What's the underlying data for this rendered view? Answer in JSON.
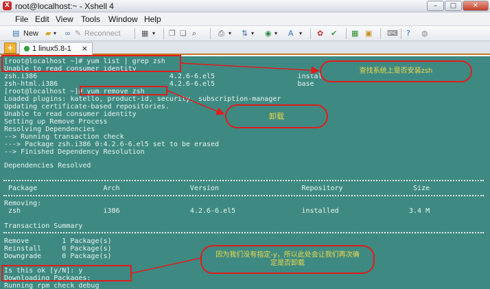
{
  "window": {
    "title": "root@localhost:~ - Xshell 4",
    "icon": "xshell-app-icon"
  },
  "menu": [
    "File",
    "Edit",
    "View",
    "Tools",
    "Window",
    "Help"
  ],
  "toolbar": {
    "new_label": "New",
    "reconnect_label": "Reconnect"
  },
  "tab": {
    "add_symbol": "+",
    "label": "1 linux5.8-1",
    "close_symbol": "×"
  },
  "terminal": {
    "lines": [
      "[root@localhost ~]# yum list | grep zsh",
      "Unable to read consumer identity",
      "zsh.i386                                4.2.6-6.el5                    installed",
      "zsh-html.i386                           4.2.6-6.el5                    base",
      "[root@localhost ~]# yum remove zsh",
      "Loaded plugins: katello, product-id, security, subscription-manager",
      "Updating certificate-based repositories.",
      "Unable to read consumer identity",
      "Setting up Remove Process",
      "Resolving Dependencies",
      "--> Running transaction check",
      "---> Package zsh.i386 0:4.2.6-6.el5 set to be erased",
      "--> Finished Dependency Resolution",
      "",
      "Dependencies Resolved",
      "",
      "",
      " Package                Arch                 Version                    Repository                 Size",
      "",
      "Removing:",
      " zsh                    i386                 4.2.6-6.el5                installed                 3.4 M",
      "",
      "Transaction Summary",
      "",
      "Remove        1 Package(s)",
      "Reinstall     0 Package(s)",
      "Downgrade     0 Package(s)",
      "",
      "Is this ok [y/N]: y",
      "Downloading Packages:",
      "Running rpm_check_debug"
    ]
  },
  "annotations": {
    "check_installed": "查找系统上是否安装zsh",
    "uninstall": "卸载",
    "confirm_note": "因为我们没有指定-y，所以此处会让我们再次确定是否卸载"
  },
  "colors": {
    "terminal_bg": "#3e8a82",
    "terminal_text": "#e9f4f2",
    "annotation_red": "#e21b1b",
    "annotation_text": "#f0d84a"
  }
}
